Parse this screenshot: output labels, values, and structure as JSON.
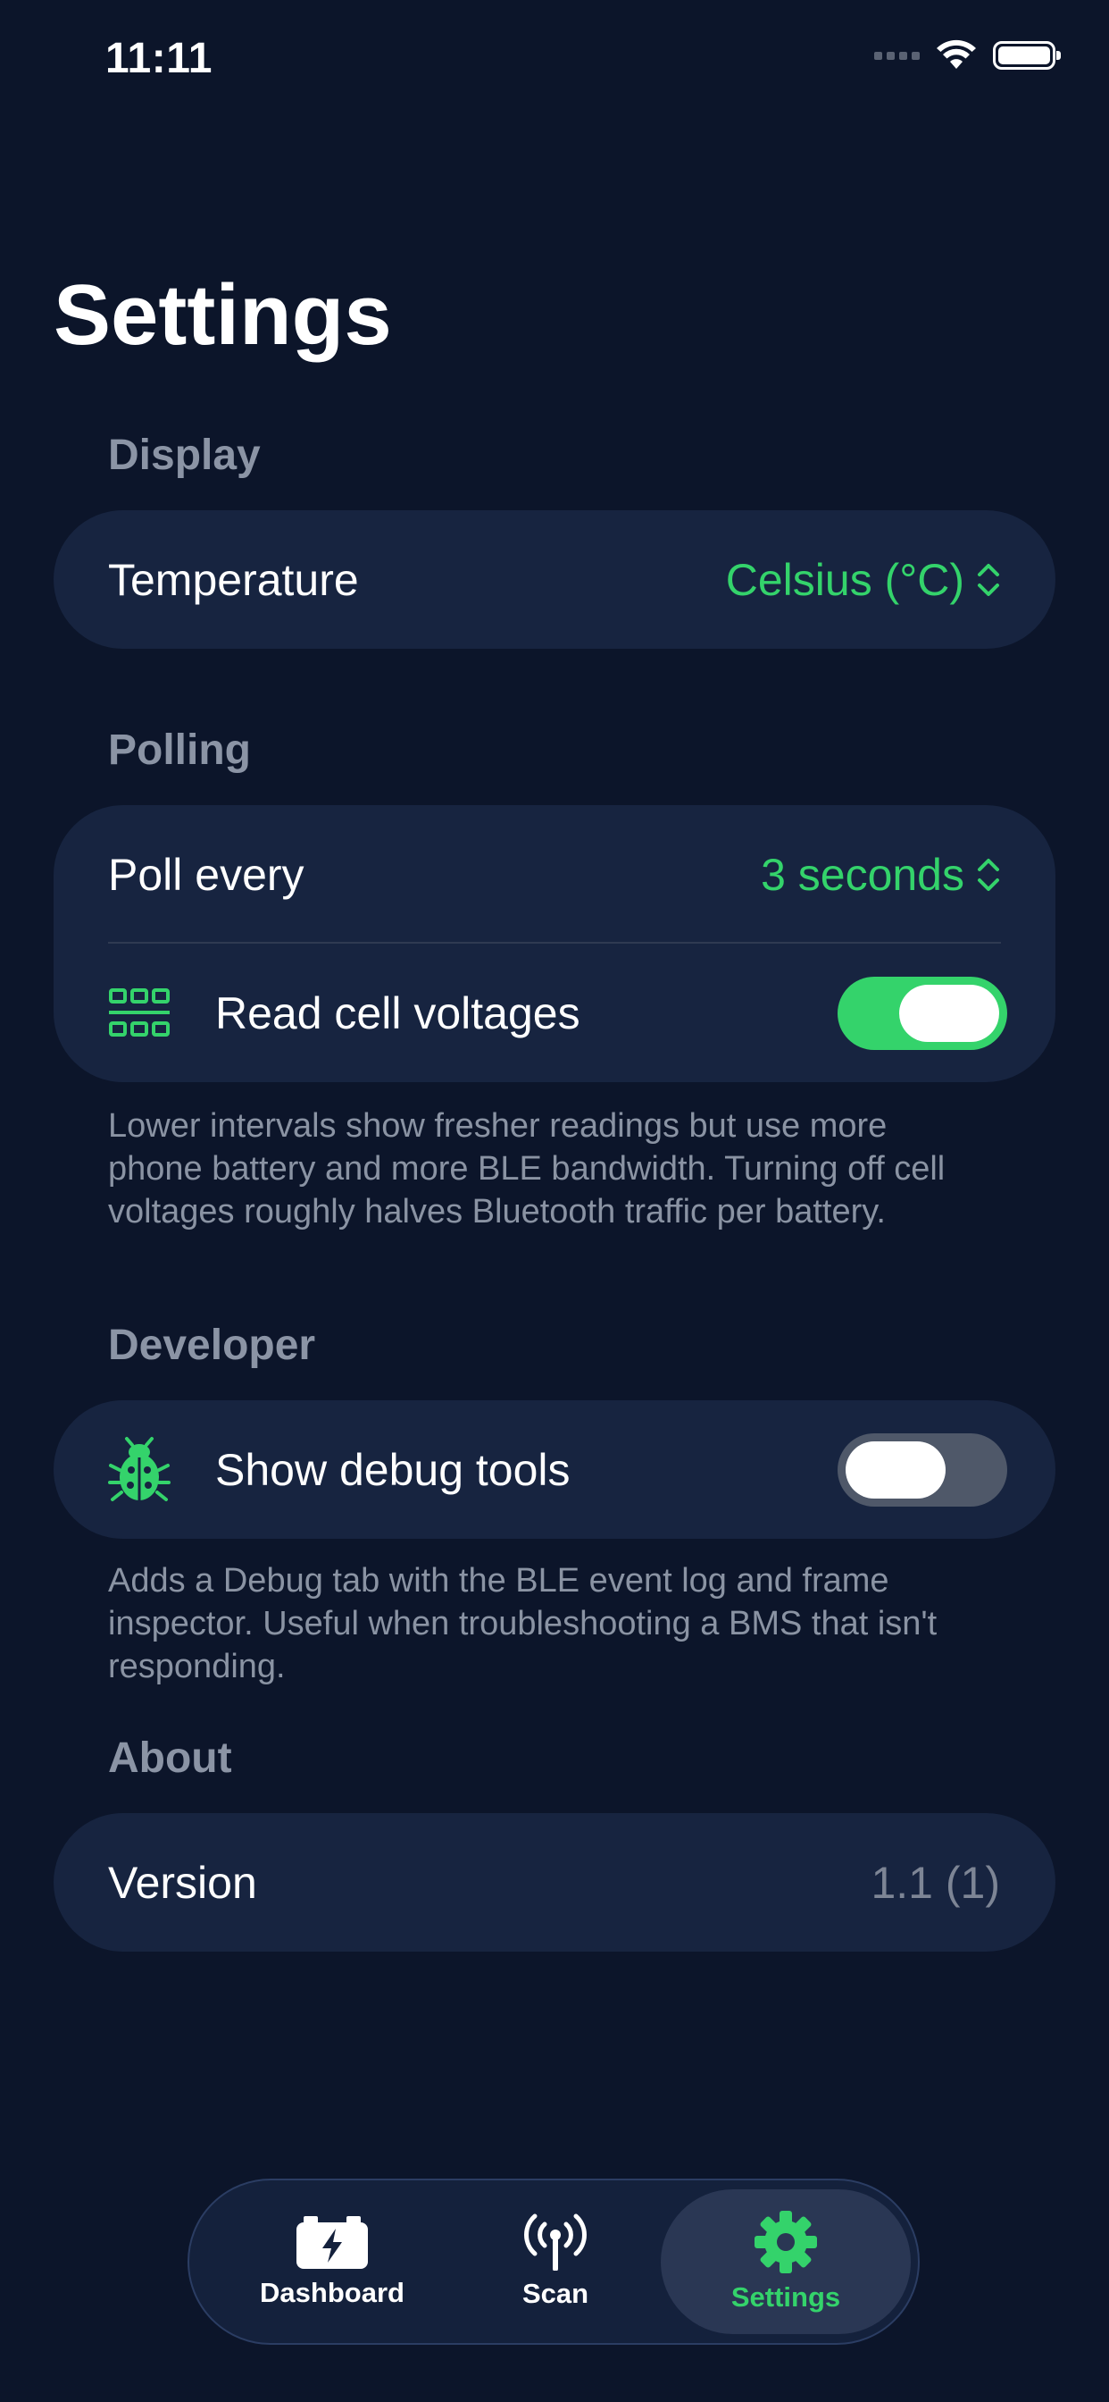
{
  "status_bar": {
    "time": "11:11"
  },
  "page_title": "Settings",
  "display": {
    "header": "Display",
    "temperature_label": "Temperature",
    "temperature_value": "Celsius (°C)"
  },
  "polling": {
    "header": "Polling",
    "poll_label": "Poll every",
    "poll_value": "3 seconds",
    "cell_voltages_label": "Read cell voltages",
    "cell_voltages_on": true,
    "footnote": "Lower intervals show fresher readings but use more phone battery and more BLE bandwidth. Turning off cell voltages roughly halves Bluetooth traffic per battery."
  },
  "developer": {
    "header": "Developer",
    "debug_label": "Show debug tools",
    "debug_on": false,
    "footnote": "Adds a Debug tab with the BLE event log and frame inspector. Useful when troubleshooting a BMS that isn't responding."
  },
  "about": {
    "header": "About",
    "version_label": "Version",
    "version_value": "1.1 (1)"
  },
  "tab_bar": {
    "tabs": [
      {
        "label": "Dashboard",
        "icon": "battery-bolt-icon",
        "active": false
      },
      {
        "label": "Scan",
        "icon": "antenna-icon",
        "active": false
      },
      {
        "label": "Settings",
        "icon": "gear-icon",
        "active": true
      }
    ]
  },
  "colors": {
    "background": "#0c152a",
    "card": "#172440",
    "accent": "#34d36b",
    "muted_text": "#8a93a3"
  }
}
